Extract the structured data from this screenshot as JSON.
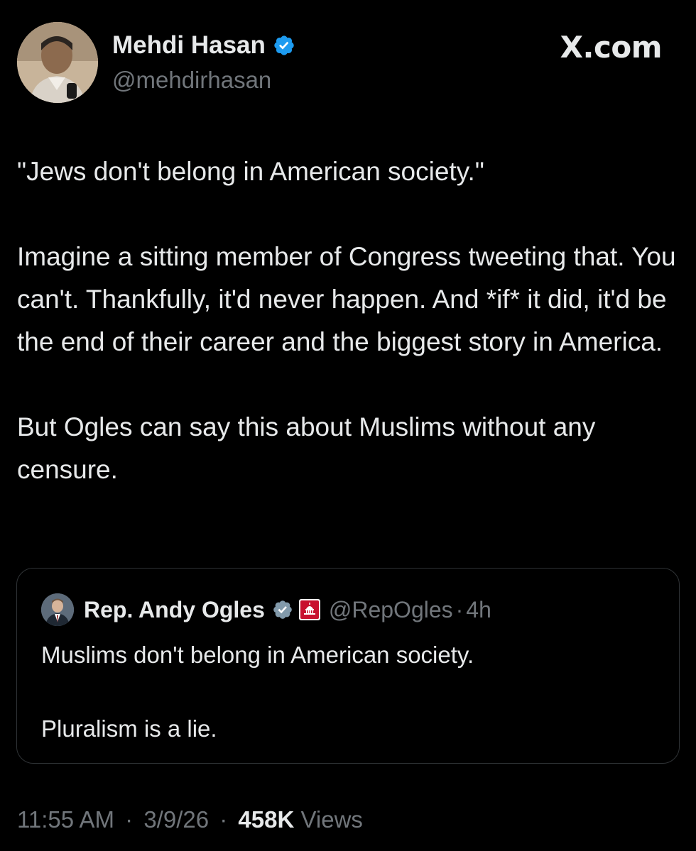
{
  "author": {
    "name": "Mehdi Hasan",
    "handle": "@mehdirhasan",
    "verified": true,
    "verified_color": "#1d9bf0"
  },
  "brand": "X.com",
  "tweet": {
    "paragraphs": [
      "\"Jews don't belong in American society.\"",
      "Imagine a sitting member of Congress tweeting that. You can't. Thankfully, it'd never happen. And *if* it did, it'd be the end of their career and the biggest story in America.",
      "But Ogles can say this about Muslims without any censure."
    ]
  },
  "quoted_tweet": {
    "name": "Rep. Andy Ogles",
    "handle": "@RepOgles",
    "separator": "·",
    "time": "4h",
    "verified": true,
    "verified_color": "#829aab",
    "affiliation_badge": "capitol-badge-icon",
    "paragraphs": [
      "Muslims don't belong in American society.",
      "Pluralism is a lie."
    ]
  },
  "meta": {
    "time": "11:55 AM",
    "separator": "·",
    "date": "3/9/26",
    "views_count": "458K",
    "views_label": "Views"
  },
  "colors": {
    "background": "#000000",
    "primary_text": "#e7e9ea",
    "secondary_text": "#71767b",
    "border": "#2f3336"
  }
}
